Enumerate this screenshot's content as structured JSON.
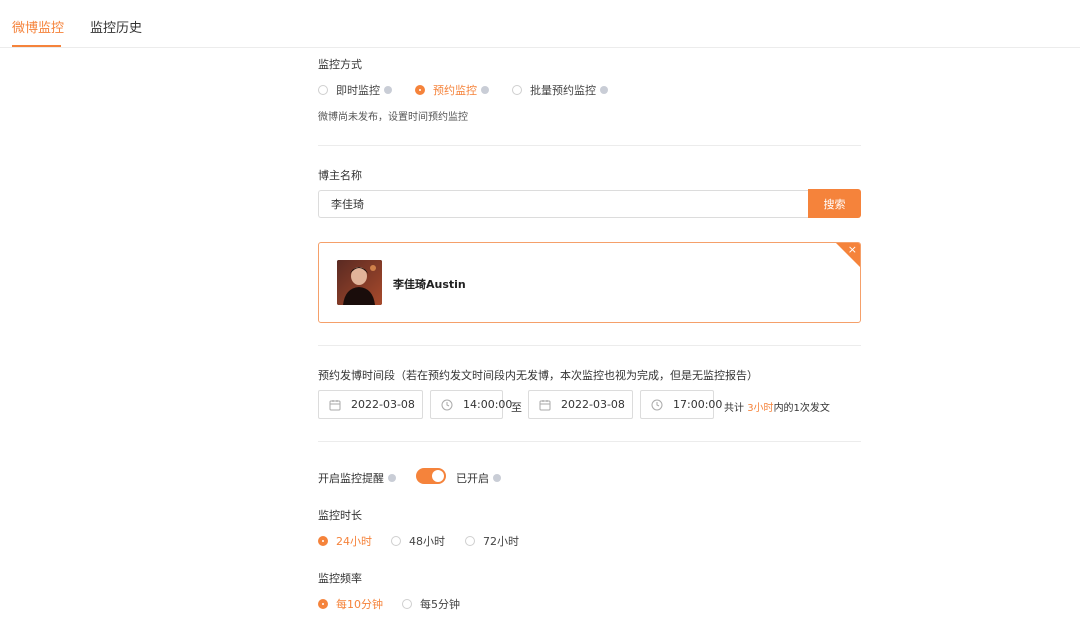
{
  "tabs": [
    {
      "label": "微博监控",
      "active": true
    },
    {
      "label": "监控历史",
      "active": false
    }
  ],
  "monitor_mode": {
    "title": "监控方式",
    "options": [
      {
        "label": "即时监控",
        "checked": false
      },
      {
        "label": "预约监控",
        "checked": true
      },
      {
        "label": "批量预约监控",
        "checked": false
      }
    ],
    "hint": "微博尚未发布，设置时间预约监控"
  },
  "blogger": {
    "title": "博主名称",
    "input_value": "李佳琦",
    "search_label": "搜索",
    "result_name": "李佳琦Austin",
    "close_glyph": "×"
  },
  "schedule": {
    "title": "预约发博时间段（若在预约发文时间段内无发博，本次监控也视为完成，但是无监控报告）",
    "start_date": "2022-03-08",
    "start_time": "14:00:00",
    "to_label": "至",
    "end_date": "2022-03-08",
    "end_time": "17:00:00",
    "summary_prefix": "共计",
    "summary_highlight": "3小时",
    "summary_suffix": "内的1次发文"
  },
  "reminder": {
    "label": "开启监控提醒",
    "enabled": true,
    "status_text": "已开启"
  },
  "duration": {
    "title": "监控时长",
    "options": [
      {
        "label": "24小时",
        "checked": true
      },
      {
        "label": "48小时",
        "checked": false
      },
      {
        "label": "72小时",
        "checked": false
      }
    ]
  },
  "frequency": {
    "title": "监控频率",
    "options": [
      {
        "label": "每10分钟",
        "checked": true
      },
      {
        "label": "每5分钟",
        "checked": false
      }
    ]
  },
  "colors": {
    "accent": "#f5833b",
    "border": "#dcdcdc",
    "info_dot": "#c9cdd6"
  }
}
